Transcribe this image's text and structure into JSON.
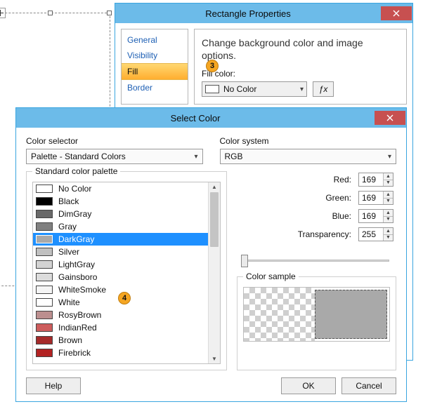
{
  "props_window": {
    "title": "Rectangle Properties",
    "categories": [
      "General",
      "Visibility",
      "Fill",
      "Border"
    ],
    "selected_index": 2,
    "description": "Change background color and image options.",
    "fill_color_label": "Fill color:",
    "fill_color_value": "No Color"
  },
  "color_window": {
    "title": "Select Color",
    "color_selector_label": "Color selector",
    "color_selector_value": "Palette - Standard Colors",
    "color_system_label": "Color system",
    "color_system_value": "RGB",
    "palette_group_label": "Standard color palette",
    "palette": [
      {
        "name": "No Color",
        "hex": "#ffffff"
      },
      {
        "name": "Black",
        "hex": "#000000"
      },
      {
        "name": "DimGray",
        "hex": "#696969"
      },
      {
        "name": "Gray",
        "hex": "#808080"
      },
      {
        "name": "DarkGray",
        "hex": "#a9a9a9"
      },
      {
        "name": "Silver",
        "hex": "#c0c0c0"
      },
      {
        "name": "LightGray",
        "hex": "#d3d3d3"
      },
      {
        "name": "Gainsboro",
        "hex": "#dcdcdc"
      },
      {
        "name": "WhiteSmoke",
        "hex": "#f5f5f5"
      },
      {
        "name": "White",
        "hex": "#ffffff"
      },
      {
        "name": "RosyBrown",
        "hex": "#bc8f8f"
      },
      {
        "name": "IndianRed",
        "hex": "#cd5c5c"
      },
      {
        "name": "Brown",
        "hex": "#a52a2a"
      },
      {
        "name": "Firebrick",
        "hex": "#b22222"
      }
    ],
    "palette_selected_index": 4,
    "channels": {
      "red_label": "Red:",
      "green_label": "Green:",
      "blue_label": "Blue:",
      "transparency_label": "Transparency:",
      "red": "169",
      "green": "169",
      "blue": "169",
      "transparency": "255"
    },
    "sample_label": "Color sample",
    "sample_hex": "#a9a9a9",
    "buttons": {
      "help": "Help",
      "ok": "OK",
      "cancel": "Cancel"
    }
  },
  "callouts": {
    "a": "3",
    "b": "4"
  }
}
